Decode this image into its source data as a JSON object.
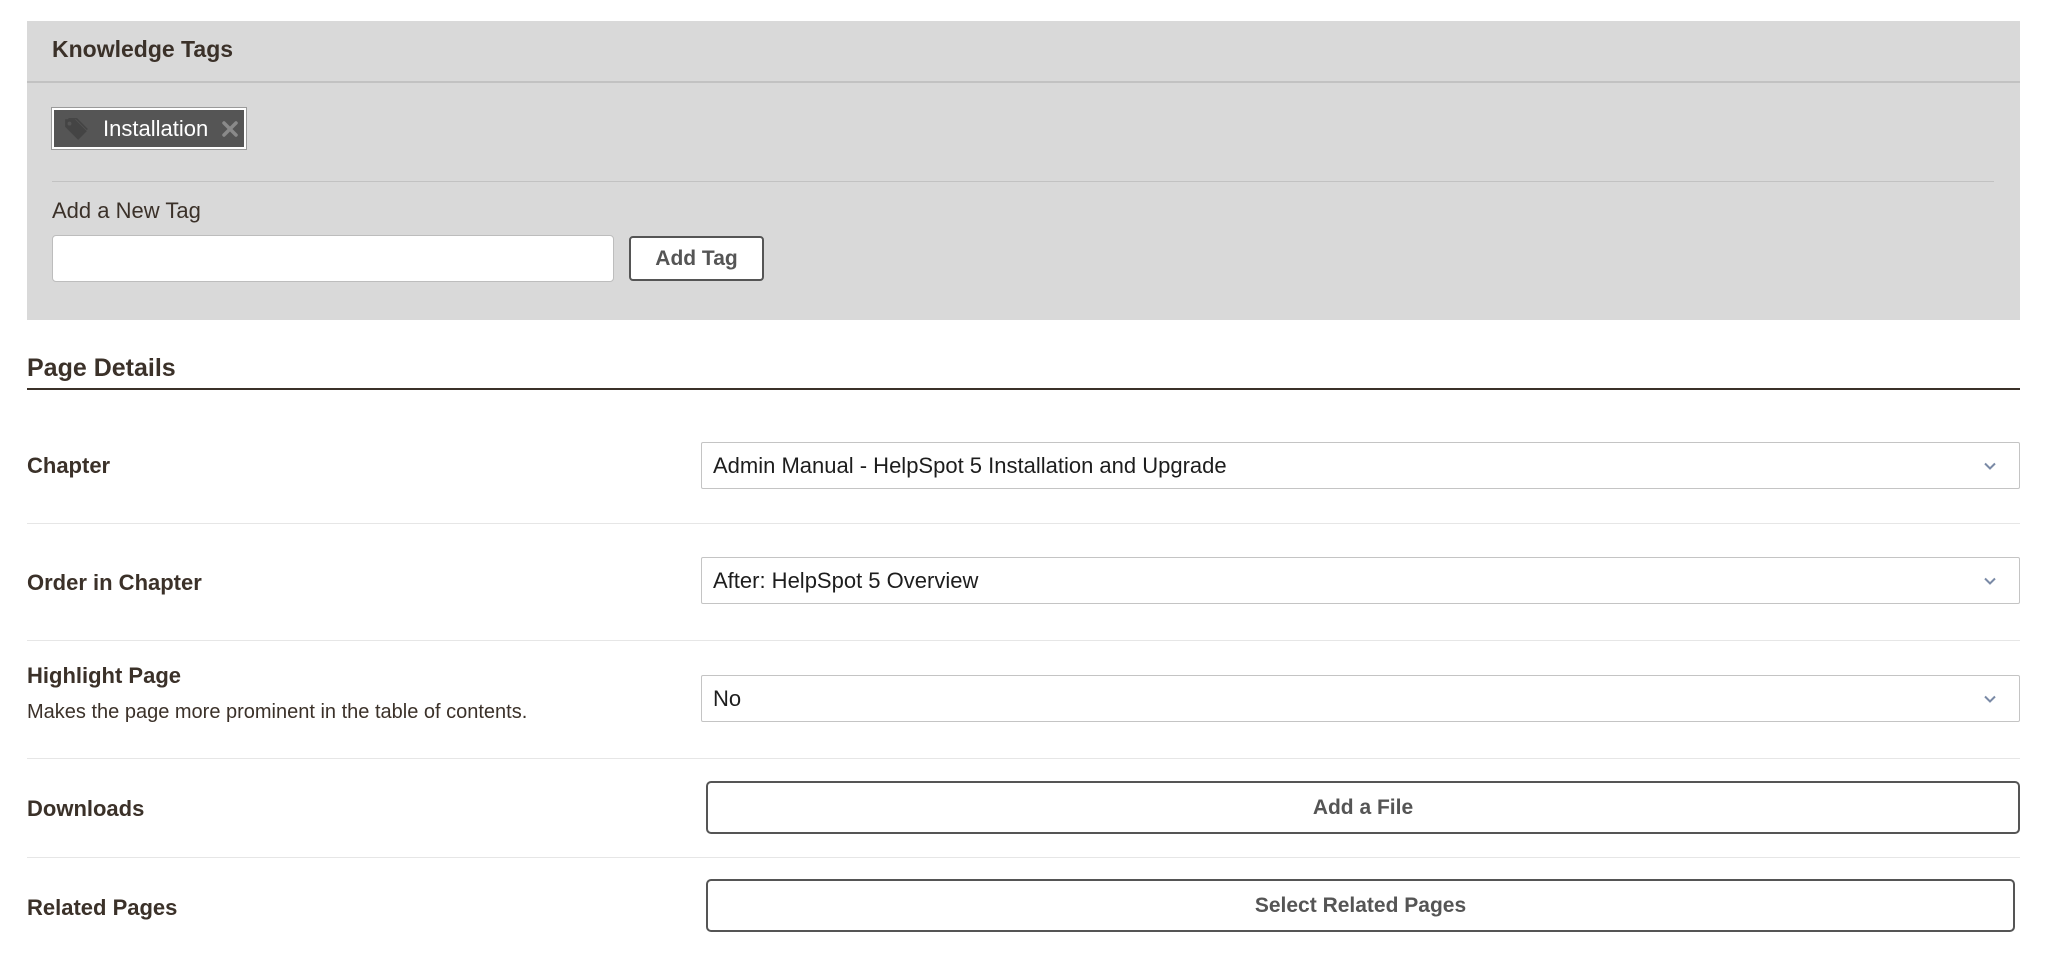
{
  "knowledge_tags": {
    "title": "Knowledge Tags",
    "tags": [
      {
        "label": "Installation",
        "icon": "tag-icon",
        "remove_icon": "close-icon"
      }
    ],
    "add_label": "Add a New Tag",
    "input_value": "",
    "input_placeholder": "",
    "add_button": "Add Tag"
  },
  "page_details": {
    "title": "Page Details",
    "chapter": {
      "label": "Chapter",
      "value": "Admin Manual - HelpSpot 5 Installation and Upgrade"
    },
    "order": {
      "label": "Order in Chapter",
      "value": "After: HelpSpot 5 Overview"
    },
    "highlight": {
      "label": "Highlight Page",
      "help": "Makes the page more prominent in the table of contents.",
      "value": "No"
    },
    "downloads": {
      "label": "Downloads",
      "button": "Add a File"
    },
    "related": {
      "label": "Related Pages",
      "button": "Select Related Pages"
    }
  },
  "colors": {
    "panel_bg": "#d9d9d9",
    "tag_bg": "#555555",
    "text": "#3b3129",
    "button_border": "#555555"
  }
}
